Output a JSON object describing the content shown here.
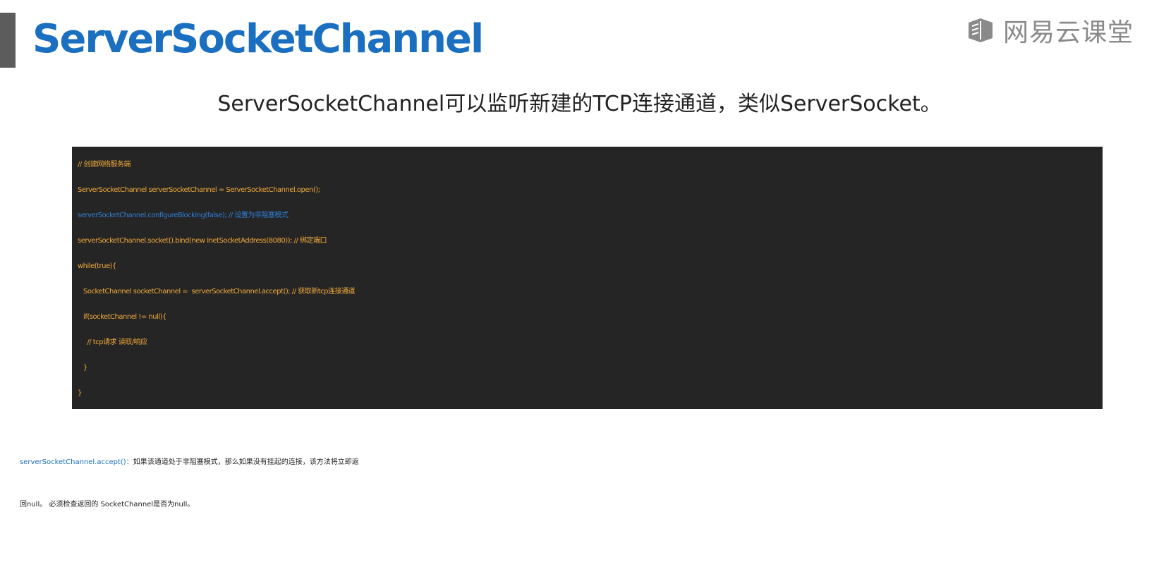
{
  "slide": {
    "title": "ServerSocketChannel",
    "logo_text": "网易云课堂",
    "subtitle": "ServerSocketChannel可以监听新建的TCP连接通道，类似ServerSocket。"
  },
  "code": {
    "lines": [
      "// 创建网络服务端",
      "ServerSocketChannel serverSocketChannel = ServerSocketChannel.open();",
      "serverSocketChannel.configureBlocking(false); // 设置为非阻塞模式",
      "serverSocketChannel.socket().bind(new InetSocketAddress(8080)); // 绑定端口",
      "while(true){",
      "   SocketChannel socketChannel =  serverSocketChannel.accept(); // 获取新tcp连接通道",
      "   if(socketChannel != null){",
      "     // tcp请求 读取/响应",
      "   }",
      "}"
    ]
  },
  "description": {
    "key": "serverSocketChannel.accept()：",
    "line1_text": "如果该通道处于非阻塞模式，那么如果没有挂起的连接，该方法将立即返",
    "line2_text": "回null。 必须检查返回的 SocketChannel是否为null。"
  },
  "colors": {
    "title_blue": "#1a6fc0",
    "code_background": "#252525",
    "code_text": "#f0a93a",
    "code_highlight": "#2f7fd6"
  }
}
